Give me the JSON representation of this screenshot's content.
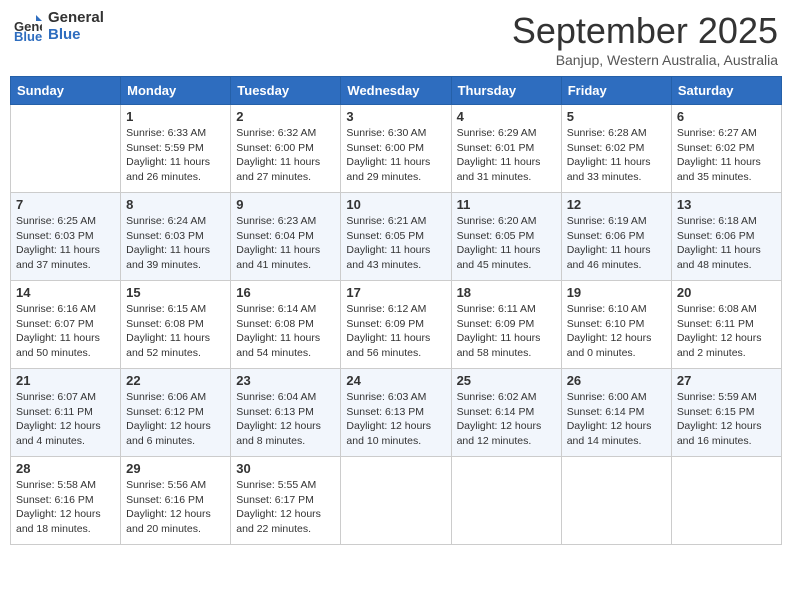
{
  "header": {
    "logo_general": "General",
    "logo_blue": "Blue",
    "month": "September 2025",
    "location": "Banjup, Western Australia, Australia"
  },
  "weekdays": [
    "Sunday",
    "Monday",
    "Tuesday",
    "Wednesday",
    "Thursday",
    "Friday",
    "Saturday"
  ],
  "weeks": [
    [
      {
        "day": "",
        "info": ""
      },
      {
        "day": "1",
        "info": "Sunrise: 6:33 AM\nSunset: 5:59 PM\nDaylight: 11 hours\nand 26 minutes."
      },
      {
        "day": "2",
        "info": "Sunrise: 6:32 AM\nSunset: 6:00 PM\nDaylight: 11 hours\nand 27 minutes."
      },
      {
        "day": "3",
        "info": "Sunrise: 6:30 AM\nSunset: 6:00 PM\nDaylight: 11 hours\nand 29 minutes."
      },
      {
        "day": "4",
        "info": "Sunrise: 6:29 AM\nSunset: 6:01 PM\nDaylight: 11 hours\nand 31 minutes."
      },
      {
        "day": "5",
        "info": "Sunrise: 6:28 AM\nSunset: 6:02 PM\nDaylight: 11 hours\nand 33 minutes."
      },
      {
        "day": "6",
        "info": "Sunrise: 6:27 AM\nSunset: 6:02 PM\nDaylight: 11 hours\nand 35 minutes."
      }
    ],
    [
      {
        "day": "7",
        "info": "Sunrise: 6:25 AM\nSunset: 6:03 PM\nDaylight: 11 hours\nand 37 minutes."
      },
      {
        "day": "8",
        "info": "Sunrise: 6:24 AM\nSunset: 6:03 PM\nDaylight: 11 hours\nand 39 minutes."
      },
      {
        "day": "9",
        "info": "Sunrise: 6:23 AM\nSunset: 6:04 PM\nDaylight: 11 hours\nand 41 minutes."
      },
      {
        "day": "10",
        "info": "Sunrise: 6:21 AM\nSunset: 6:05 PM\nDaylight: 11 hours\nand 43 minutes."
      },
      {
        "day": "11",
        "info": "Sunrise: 6:20 AM\nSunset: 6:05 PM\nDaylight: 11 hours\nand 45 minutes."
      },
      {
        "day": "12",
        "info": "Sunrise: 6:19 AM\nSunset: 6:06 PM\nDaylight: 11 hours\nand 46 minutes."
      },
      {
        "day": "13",
        "info": "Sunrise: 6:18 AM\nSunset: 6:06 PM\nDaylight: 11 hours\nand 48 minutes."
      }
    ],
    [
      {
        "day": "14",
        "info": "Sunrise: 6:16 AM\nSunset: 6:07 PM\nDaylight: 11 hours\nand 50 minutes."
      },
      {
        "day": "15",
        "info": "Sunrise: 6:15 AM\nSunset: 6:08 PM\nDaylight: 11 hours\nand 52 minutes."
      },
      {
        "day": "16",
        "info": "Sunrise: 6:14 AM\nSunset: 6:08 PM\nDaylight: 11 hours\nand 54 minutes."
      },
      {
        "day": "17",
        "info": "Sunrise: 6:12 AM\nSunset: 6:09 PM\nDaylight: 11 hours\nand 56 minutes."
      },
      {
        "day": "18",
        "info": "Sunrise: 6:11 AM\nSunset: 6:09 PM\nDaylight: 11 hours\nand 58 minutes."
      },
      {
        "day": "19",
        "info": "Sunrise: 6:10 AM\nSunset: 6:10 PM\nDaylight: 12 hours\nand 0 minutes."
      },
      {
        "day": "20",
        "info": "Sunrise: 6:08 AM\nSunset: 6:11 PM\nDaylight: 12 hours\nand 2 minutes."
      }
    ],
    [
      {
        "day": "21",
        "info": "Sunrise: 6:07 AM\nSunset: 6:11 PM\nDaylight: 12 hours\nand 4 minutes."
      },
      {
        "day": "22",
        "info": "Sunrise: 6:06 AM\nSunset: 6:12 PM\nDaylight: 12 hours\nand 6 minutes."
      },
      {
        "day": "23",
        "info": "Sunrise: 6:04 AM\nSunset: 6:13 PM\nDaylight: 12 hours\nand 8 minutes."
      },
      {
        "day": "24",
        "info": "Sunrise: 6:03 AM\nSunset: 6:13 PM\nDaylight: 12 hours\nand 10 minutes."
      },
      {
        "day": "25",
        "info": "Sunrise: 6:02 AM\nSunset: 6:14 PM\nDaylight: 12 hours\nand 12 minutes."
      },
      {
        "day": "26",
        "info": "Sunrise: 6:00 AM\nSunset: 6:14 PM\nDaylight: 12 hours\nand 14 minutes."
      },
      {
        "day": "27",
        "info": "Sunrise: 5:59 AM\nSunset: 6:15 PM\nDaylight: 12 hours\nand 16 minutes."
      }
    ],
    [
      {
        "day": "28",
        "info": "Sunrise: 5:58 AM\nSunset: 6:16 PM\nDaylight: 12 hours\nand 18 minutes."
      },
      {
        "day": "29",
        "info": "Sunrise: 5:56 AM\nSunset: 6:16 PM\nDaylight: 12 hours\nand 20 minutes."
      },
      {
        "day": "30",
        "info": "Sunrise: 5:55 AM\nSunset: 6:17 PM\nDaylight: 12 hours\nand 22 minutes."
      },
      {
        "day": "",
        "info": ""
      },
      {
        "day": "",
        "info": ""
      },
      {
        "day": "",
        "info": ""
      },
      {
        "day": "",
        "info": ""
      }
    ]
  ]
}
